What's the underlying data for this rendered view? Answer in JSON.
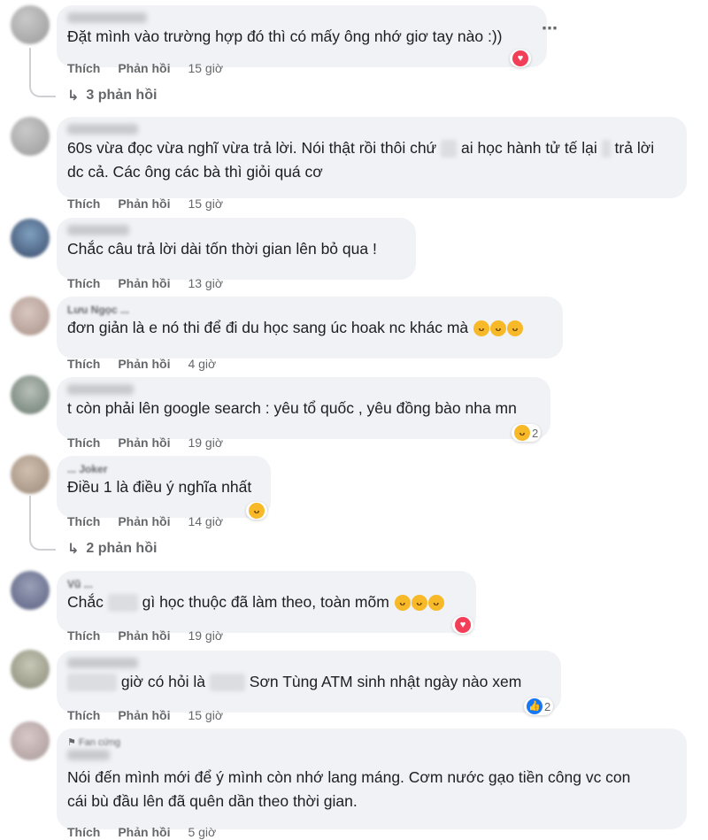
{
  "labels": {
    "like": "Thích",
    "reply": "Phản hồi"
  },
  "more_icon": "⋯",
  "comments": [
    {
      "text": "Đặt mình vào trường hợp đó thì có mấy ông nhớ giơ tay nào :))",
      "time": "15 giờ",
      "replies": "3 phản hồi"
    },
    {
      "text_a": "60s vừa đọc vừa nghĩ vừa trả lời. Nói thật rồi thôi chứ",
      "text_b": "ai học hành tử tế lại",
      "text_c": "trả lời",
      "text_d": "dc cả. Các ông các bà thì giỏi quá cơ",
      "time": "15 giờ"
    },
    {
      "text": "Chắc câu trả lời dài tốn thời gian lên bỏ qua !",
      "time": "13 giờ"
    },
    {
      "name": "Lưu Ngọc ...",
      "text": "đơn giản là e nó thi để đi du học sang úc hoak nc khác mà",
      "time": "4 giờ"
    },
    {
      "text": "t còn phải lên google search : yêu tổ quốc , yêu đồng bào nha mn",
      "time": "19 giờ",
      "reaction_count": "2"
    },
    {
      "name": "... Joker",
      "text": "Điều 1 là điều ý nghĩa nhất",
      "time": "14 giờ",
      "replies": "2 phản hồi"
    },
    {
      "name": "Vũ ...",
      "text_a": "Chắc",
      "text_b": "gì học thuộc đã làm theo, toàn mõm",
      "time": "19 giờ"
    },
    {
      "text_a": "giờ có hỏi là",
      "text_b": "Sơn Tùng ATM sinh nhật ngày nào xem",
      "time": "15 giờ",
      "reaction_count": "2"
    },
    {
      "name": "Fan cứng",
      "text_a": "Nói đến mình mới để ý mình còn nhớ lang máng. Cơm nước gạo tiền công vc con",
      "text_b": "cái bù đầu lên đã quên dần theo thời gian.",
      "time": "5 giờ"
    }
  ],
  "colors": {
    "bubble": "#f0f2f5",
    "meta": "#65676b",
    "laugh": "#f7b928",
    "heart": "#f33e58",
    "like": "#1877f2"
  },
  "icons": [
    "laugh-emoji-icon",
    "heart-reaction-icon",
    "like-reaction-icon",
    "reply-arrow-icon",
    "more-options-icon",
    "fan-badge-icon"
  ]
}
